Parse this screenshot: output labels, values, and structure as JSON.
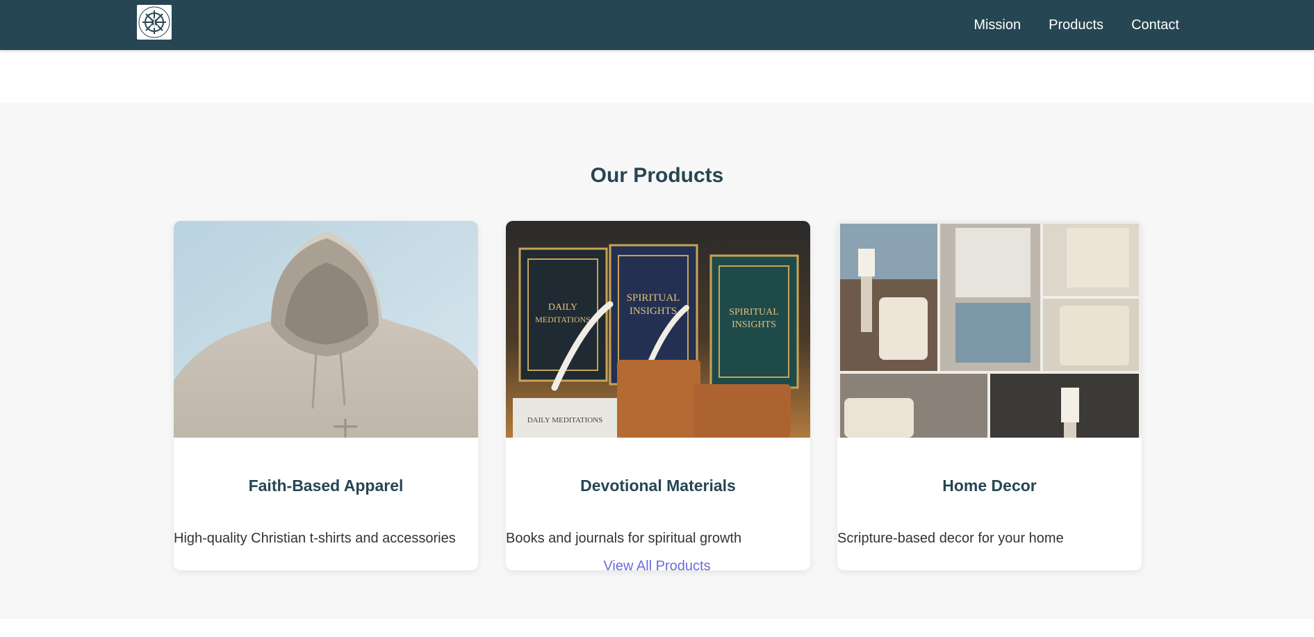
{
  "header": {
    "logo_alt": "Anchored in Christ",
    "nav": [
      {
        "label": "Mission"
      },
      {
        "label": "Products"
      },
      {
        "label": "Contact"
      }
    ]
  },
  "products": {
    "title": "Our Products",
    "cards": [
      {
        "title": "Faith-Based Apparel",
        "description": "High-quality Christian t-shirts and accessories",
        "image": "hoodie-photo"
      },
      {
        "title": "Devotional Materials",
        "description": "Books and journals for spiritual growth",
        "image": "devotional-books-photo"
      },
      {
        "title": "Home Decor",
        "description": "Scripture-based decor for your home",
        "image": "home-decor-collage-photo"
      }
    ],
    "view_all_label": "View All Products"
  },
  "colors": {
    "navbar": "#264653",
    "heading": "#264653",
    "link": "#6a6ae0",
    "section_bg": "#f7f7f7"
  }
}
